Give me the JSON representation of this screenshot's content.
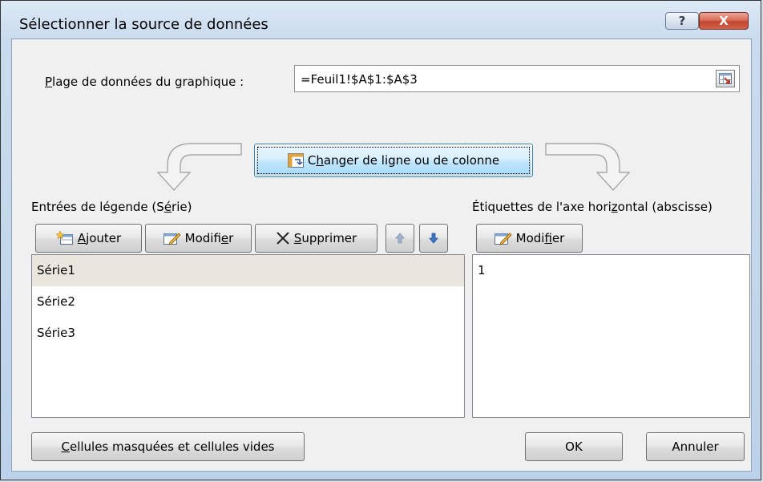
{
  "window": {
    "title": "Sélectionner la source de données",
    "help_glyph": "?",
    "close_glyph": "X"
  },
  "range": {
    "label_accel": "P",
    "label_rest": "lage de données du graphique :",
    "value": "=Feuil1!$A$1:$A$3"
  },
  "switch_button": {
    "pre": "C",
    "accel": "h",
    "post": "anger de ligne ou de colonne"
  },
  "legend": {
    "label_pre": "Entrées de légende (S",
    "label_accel": "é",
    "label_post": "rie)",
    "add": {
      "accel": "A",
      "rest": "jouter"
    },
    "edit": {
      "pre": "Modifi",
      "accel": "e",
      "post": "r"
    },
    "delete": {
      "accel": "S",
      "rest": "upprimer"
    },
    "series": [
      "Série1",
      "Série2",
      "Série3"
    ],
    "selected_index": 0
  },
  "axis": {
    "label_pre": "Étiquettes de l'axe hori",
    "label_accel": "z",
    "label_post": "ontal (abscisse)",
    "edit": {
      "pre": "Modi",
      "accel": "f",
      "post": "ier"
    },
    "items": [
      "1"
    ]
  },
  "footer": {
    "hidden_cells": {
      "accel": "C",
      "rest": "ellules masquées et cellules vides"
    },
    "ok": "OK",
    "cancel": "Annuler"
  },
  "icons": [
    "help-icon",
    "close-icon",
    "range-picker-icon",
    "switch-row-column-icon",
    "add-icon",
    "edit-icon",
    "delete-icon",
    "move-up-icon",
    "move-down-icon",
    "curved-arrow-left-icon",
    "curved-arrow-right-icon"
  ]
}
